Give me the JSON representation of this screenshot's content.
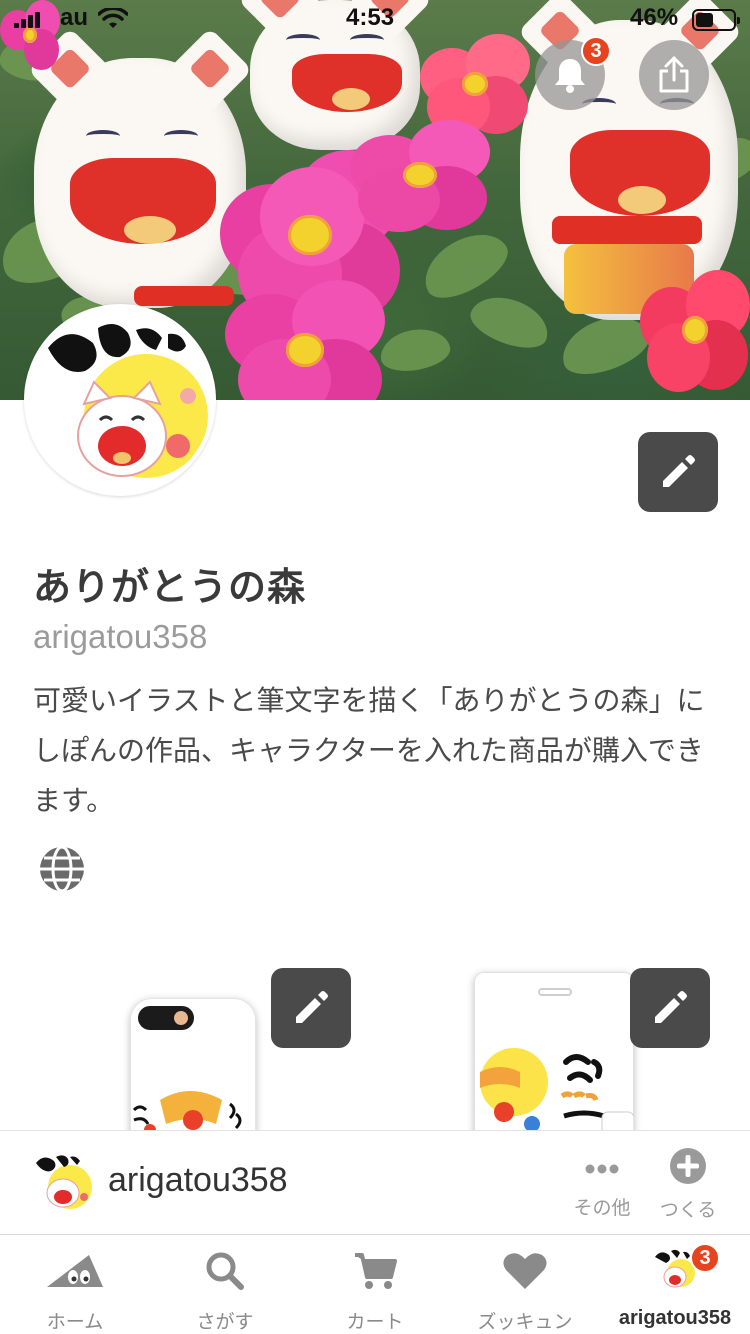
{
  "status_bar": {
    "carrier": "au",
    "time": "4:53",
    "battery_percent": "46%",
    "battery_level": 0.46
  },
  "header": {
    "notification_badge": "3"
  },
  "profile": {
    "name": "ありがとうの森",
    "handle": "arigatou358",
    "description": "可愛いイラストと筆文字を描く「ありがとうの森」にしぽんの作品、キャラクターを入れた商品が購入できます。"
  },
  "shop_bar": {
    "name": "arigatou358",
    "more_label": "その他",
    "create_label": "つくる"
  },
  "tabs": [
    {
      "label": "ホーム",
      "icon": "home-icon"
    },
    {
      "label": "さがす",
      "icon": "search-icon"
    },
    {
      "label": "カート",
      "icon": "cart-icon"
    },
    {
      "label": "ズッキュン",
      "icon": "heart-icon"
    },
    {
      "label": "arigatou358",
      "icon": "avatar",
      "badge": "3"
    }
  ],
  "colors": {
    "badge": "#e8431f",
    "edit_button": "#4a4a4a",
    "text_primary": "#3a3a3a",
    "text_muted": "#9b9b9b"
  }
}
